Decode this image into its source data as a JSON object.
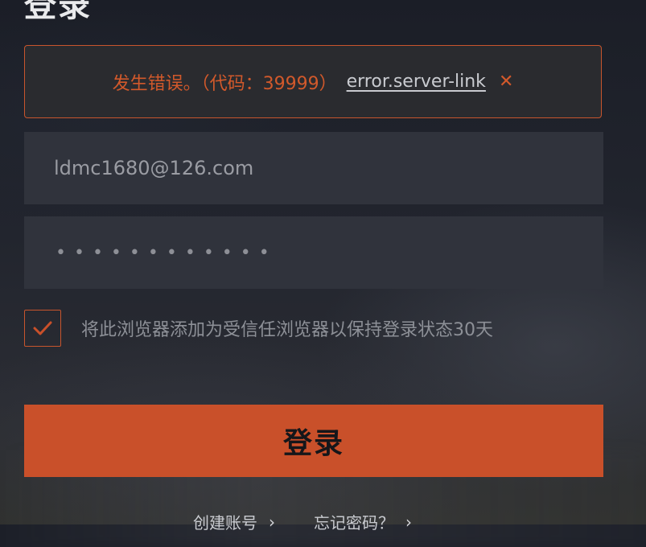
{
  "title": "登录",
  "error": {
    "message": "发生错误。（代码：39999）",
    "link_text": "error.server-link",
    "close_icon": "✕"
  },
  "email_field": {
    "value": "ldmc1680@126.com",
    "placeholder": ""
  },
  "password_field": {
    "masked_value": "••••••••••••"
  },
  "remember": {
    "checked": true,
    "label": "将此浏览器添加为受信任浏览器以保持登录状态30天"
  },
  "login_button": {
    "label": "登录"
  },
  "footer_links": [
    {
      "label": "创建账号",
      "icon": "chevron-right-icon"
    },
    {
      "label": "忘记密码？",
      "icon": "chevron-right-icon"
    }
  ],
  "colors": {
    "accent": "#c9502a",
    "error": "#d2592b",
    "field_bg": "#30333c",
    "page_bg": "#1d2029"
  }
}
